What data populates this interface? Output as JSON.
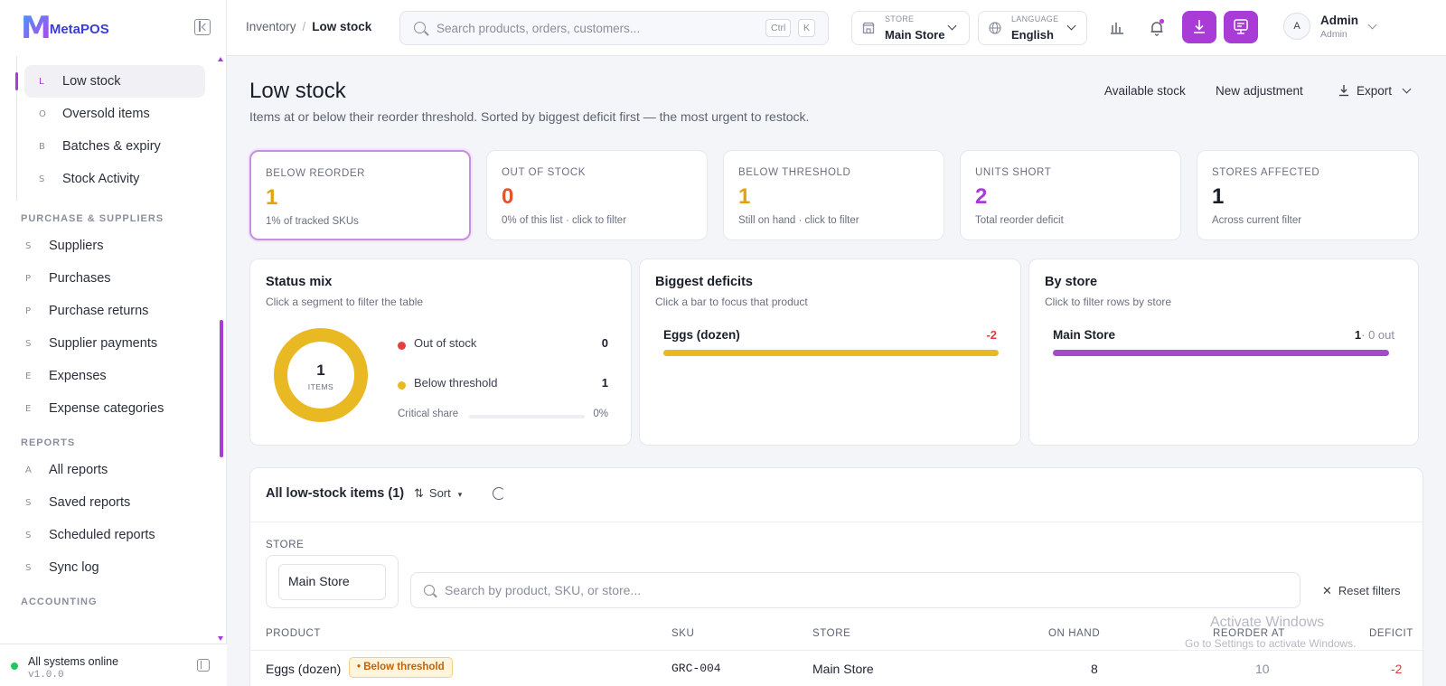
{
  "brand": {
    "logo_text": "MetaPOS"
  },
  "sidebar": {
    "sub_items": [
      {
        "letter": "L",
        "label": "Low stock"
      },
      {
        "letter": "O",
        "label": "Oversold items"
      },
      {
        "letter": "B",
        "label": "Batches & expiry"
      },
      {
        "letter": "S",
        "label": "Stock Activity"
      }
    ],
    "groups": [
      {
        "title": "PURCHASE & SUPPLIERS",
        "items": [
          {
            "letter": "S",
            "label": "Suppliers"
          },
          {
            "letter": "P",
            "label": "Purchases"
          },
          {
            "letter": "P",
            "label": "Purchase returns"
          },
          {
            "letter": "S",
            "label": "Supplier payments"
          },
          {
            "letter": "E",
            "label": "Expenses"
          },
          {
            "letter": "E",
            "label": "Expense categories"
          }
        ]
      },
      {
        "title": "REPORTS",
        "items": [
          {
            "letter": "A",
            "label": "All reports"
          },
          {
            "letter": "S",
            "label": "Saved reports"
          },
          {
            "letter": "S",
            "label": "Scheduled reports"
          },
          {
            "letter": "S",
            "label": "Sync log"
          }
        ]
      },
      {
        "title": "ACCOUNTING",
        "items": []
      }
    ],
    "status": {
      "text": "All systems online",
      "version": "v1.0.0"
    }
  },
  "topbar": {
    "breadcrumb": {
      "parent": "Inventory",
      "sep": "/",
      "current": "Low stock"
    },
    "search_placeholder": "Search products, orders, customers...",
    "kbd1": "Ctrl",
    "kbd2": "K",
    "store": {
      "label": "STORE",
      "value": "Main Store"
    },
    "language": {
      "label": "LANGUAGE",
      "value": "English"
    },
    "user": {
      "initial": "A",
      "name": "Admin",
      "role": "Admin"
    }
  },
  "page": {
    "title": "Low stock",
    "subtitle": "Items at or below their reorder threshold. Sorted by biggest deficit first — the most urgent to restock.",
    "actions": {
      "available": "Available stock",
      "adjust": "New adjustment",
      "export": "Export"
    }
  },
  "stats": [
    {
      "label": "BELOW REORDER",
      "value": "1",
      "note": "1% of tracked SKUs",
      "color": "#e0a412"
    },
    {
      "label": "OUT OF STOCK",
      "value": "0",
      "note": "0% of this list · click to filter",
      "color": "#e5532b"
    },
    {
      "label": "BELOW THRESHOLD",
      "value": "1",
      "note": "Still on hand · click to filter",
      "color": "#e0a412"
    },
    {
      "label": "UNITS SHORT",
      "value": "2",
      "note": "Total reorder deficit",
      "color": "#a93bd6"
    },
    {
      "label": "STORES AFFECTED",
      "value": "1",
      "note": "Across current filter",
      "color": "#1a1e28"
    }
  ],
  "status_mix": {
    "title": "Status mix",
    "sub": "Click a segment to filter the table",
    "center_value": "1",
    "center_label": "ITEMS",
    "legend": [
      {
        "label": "Out of stock",
        "value": "0",
        "color": "#e53e3e"
      },
      {
        "label": "Below threshold",
        "value": "1",
        "color": "#e8b923"
      }
    ],
    "critical_label": "Critical share",
    "critical_value": "0%"
  },
  "deficits": {
    "title": "Biggest deficits",
    "sub": "Click a bar to focus that product",
    "items": [
      {
        "name": "Eggs (dozen)",
        "value": "-2",
        "fraction": 1.0,
        "color": "#e8b923"
      }
    ]
  },
  "by_store": {
    "title": "By store",
    "sub": "Click to filter rows by store",
    "items": [
      {
        "name": "Main Store",
        "count": "1",
        "out": "· 0 out",
        "fraction": 1.0,
        "color": "#a54bc9"
      }
    ]
  },
  "table": {
    "title": "All low-stock items (1)",
    "sort_label": "Sort",
    "store_filter_label": "STORE",
    "store_filter_value": "Main Store",
    "search_placeholder": "Search by product, SKU, or store...",
    "reset_label": "Reset filters",
    "columns": [
      "PRODUCT",
      "SKU",
      "STORE",
      "ON HAND",
      "REORDER AT",
      "DEFICIT"
    ],
    "rows": [
      {
        "product": "Eggs (dozen)",
        "badge": "• Below threshold",
        "sku": "GRC-004",
        "store": "Main Store",
        "on_hand": "8",
        "reorder_at": "10",
        "deficit": "-2"
      }
    ]
  },
  "watermark": {
    "line1": "Activate Windows",
    "line2": "Go to Settings to activate Windows."
  }
}
